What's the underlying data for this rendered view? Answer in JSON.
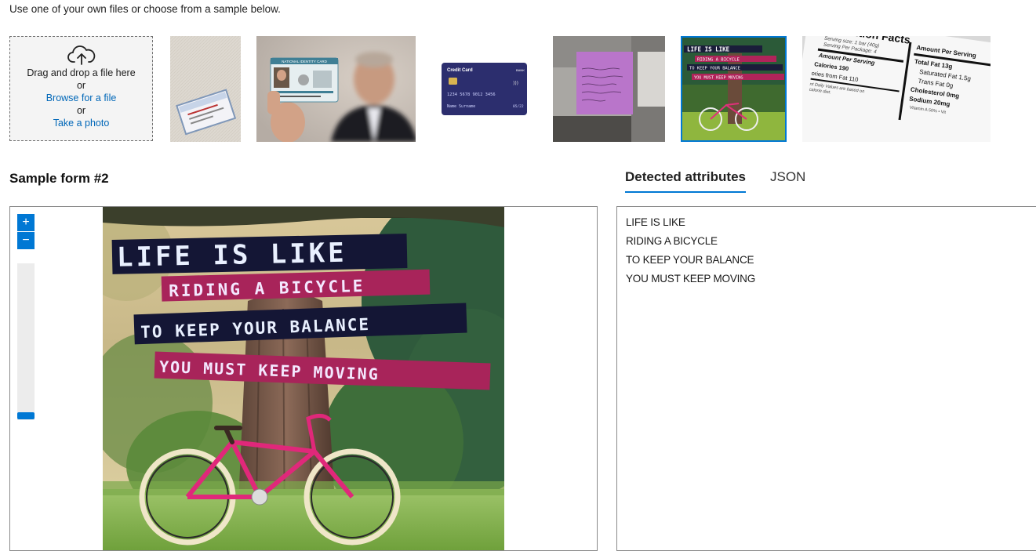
{
  "intro_text": "Use one of your own files or choose from a sample below.",
  "upload": {
    "drag_text": "Drag and drop a file here",
    "or_1": "or",
    "browse_label": "Browse for a file",
    "or_2": "or",
    "photo_label": "Take a photo",
    "icon": "cloud-upload-icon"
  },
  "samples": {
    "id_card_title": "NATIONAL IDENTITY CARD",
    "credit_card": {
      "brand": "Credit Card",
      "bank": "BANK",
      "number": "1234 5678 9012 3456",
      "holder": "Name Surname",
      "expiry": "05/22"
    },
    "nutrition": {
      "title": "Nutrition Facts",
      "serving_size": "Serving size: 1 bar (40g)",
      "servings_per_package": "Serving Per Package: 4",
      "amount_per_serving": "Amount Per Serving",
      "calories": "Calories 190",
      "calories_fat": "ories from Fat 110",
      "daily_values": "nt Daily Values are based on",
      "calorie_diet": "calorie diet.",
      "amount_per_serving_2": "Amount Per Serving",
      "total_fat": "Total Fat 13g",
      "saturated_fat": "Saturated Fat 1.5g",
      "trans_fat": "Trans Fat 0g",
      "cholesterol": "Cholesterol 0mg",
      "sodium": "Sodium 20mg",
      "vitamin": "Vitamin A 50% • Vit"
    }
  },
  "sample_title": "Sample form #2",
  "tabs": {
    "detected": "Detected attributes",
    "json": "JSON"
  },
  "zoom": {
    "in_icon": "+",
    "out_icon": "−",
    "level": 0.05
  },
  "poster_lines": [
    "LIFE IS LIKE",
    "RIDING A BICYCLE",
    "TO KEEP YOUR BALANCE",
    "YOU MUST KEEP MOVING"
  ],
  "detected_lines": [
    "LIFE IS LIKE",
    "RIDING A BICYCLE",
    "TO KEEP YOUR BALANCE",
    "YOU MUST KEEP MOVING"
  ],
  "colors": {
    "accent": "#0078d4",
    "link": "#0067b8"
  }
}
